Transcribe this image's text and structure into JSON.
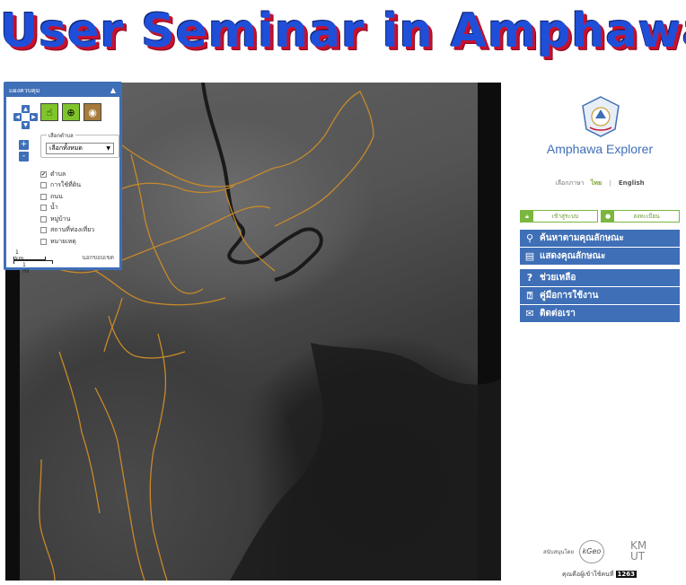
{
  "banner": {
    "title": "User Seminar in Amphawa"
  },
  "layer_panel": {
    "header": "แผงควบคุม",
    "collapse_icon": "chevron-up-icon",
    "pan_icons": [
      "arrow-up-icon",
      "arrow-left-icon",
      "arrow-right-icon",
      "arrow-down-icon"
    ],
    "zoom_in": "+",
    "zoom_out": "-",
    "tools": [
      "hand-pointer-icon",
      "magnifier-zoom-icon",
      "measure-tape-icon"
    ],
    "select_legend": "เลือกตำบล",
    "select_value": "เลือกทั้งหมด",
    "layers": [
      {
        "label": "ตำบล",
        "checked": true,
        "mark": "✔"
      },
      {
        "label": "การใช้ที่ดิน",
        "checked": false,
        "mark": ""
      },
      {
        "label": "ถนน",
        "checked": false,
        "mark": ""
      },
      {
        "label": "น้ำ",
        "checked": false,
        "mark": ""
      },
      {
        "label": "หมู่บ้าน",
        "checked": false,
        "mark": ""
      },
      {
        "label": "สถานที่ท่องเที่ยว",
        "checked": false,
        "mark": ""
      },
      {
        "label": "หมายเหตุ",
        "checked": false,
        "mark": ""
      }
    ],
    "scale_km": "1 km",
    "scale_mi": "1 mi",
    "outside_label": "นอกขอบเขต"
  },
  "sidebar": {
    "app_title": "Amphawa Explorer",
    "language_label": "เลือกภาษา",
    "lang_thai": "ไทย",
    "lang_separator": "|",
    "lang_english": "English",
    "login_label": "เข้าสู่ระบบ",
    "register_label": "ลงทะเบียน",
    "menu": [
      {
        "label": "ค้นหาตามคุณลักษณะ",
        "icon": "search-icon",
        "glyph": "⚲"
      },
      {
        "label": "แสดงคุณลักษณะ",
        "icon": "document-icon",
        "glyph": "▤"
      },
      {
        "label": "ช่วยเหลือ",
        "icon": "help-icon",
        "glyph": "?"
      },
      {
        "label": "คู่มือการใช้งาน",
        "icon": "manual-icon",
        "glyph": "⍰"
      },
      {
        "label": "ติดต่อเรา",
        "icon": "mail-icon",
        "glyph": "✉"
      }
    ],
    "partner_1": "สนับสนุนโดย",
    "partner_2": "kGeo",
    "partner_3": "KM UT",
    "visitor_label": "คุณคือผู้เข้าใช้คนที่",
    "visitor_count": "1263"
  },
  "colors": {
    "accent_blue": "#3f6fb7",
    "accent_green": "#7ab640",
    "boundary_orange": "#c8892a",
    "banner_blue": "#1f4fd8",
    "banner_shadow_red": "#c8102e"
  }
}
